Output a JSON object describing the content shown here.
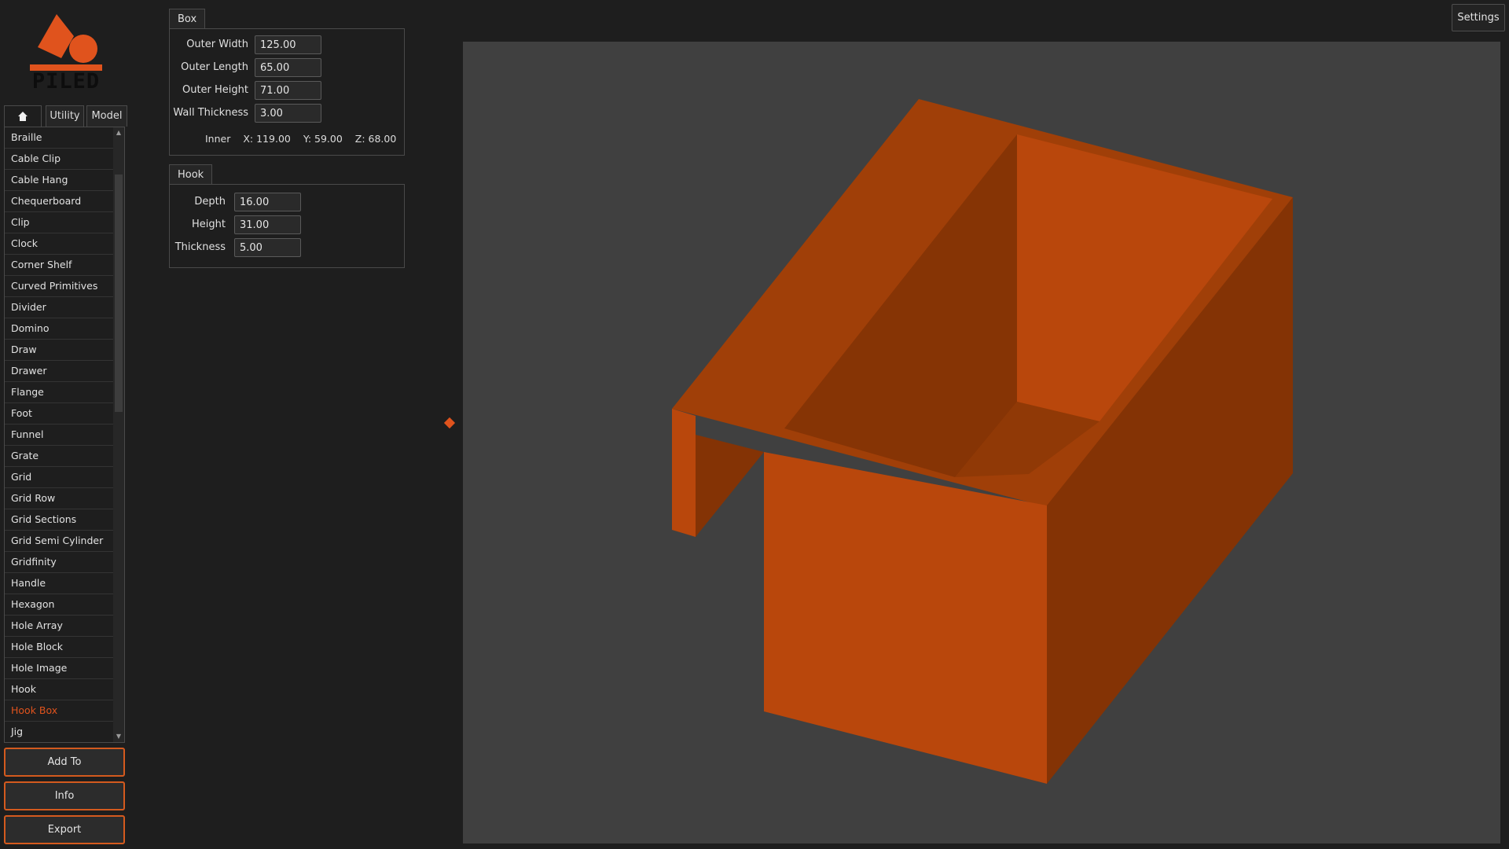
{
  "logo": {
    "text": "PILED"
  },
  "tabs": {
    "home_icon": "home-icon",
    "utility": "Utility",
    "model": "Model"
  },
  "model_list": {
    "items": [
      "Braille",
      "Cable Clip",
      "Cable Hang",
      "Chequerboard",
      "Clip",
      "Clock",
      "Corner Shelf",
      "Curved Primitives",
      "Divider",
      "Domino",
      "Draw",
      "Drawer",
      "Flange",
      "Foot",
      "Funnel",
      "Grate",
      "Grid",
      "Grid Row",
      "Grid Sections",
      "Grid Semi Cylinder",
      "Gridfinity",
      "Handle",
      "Hexagon",
      "Hole Array",
      "Hole Block",
      "Hole Image",
      "Hook",
      "Hook Box",
      "Jig"
    ],
    "selected": "Hook Box"
  },
  "buttons": {
    "add_to": "Add To",
    "info": "Info",
    "export": "Export",
    "settings": "Settings"
  },
  "box_group": {
    "title": "Box",
    "outer_width_label": "Outer Width",
    "outer_width": "125.00",
    "outer_length_label": "Outer Length",
    "outer_length": "65.00",
    "outer_height_label": "Outer Height",
    "outer_height": "71.00",
    "wall_thickness_label": "Wall Thickness",
    "wall_thickness": "3.00",
    "inner_label": "Inner",
    "inner_x": "X: 119.00",
    "inner_y": "Y: 59.00",
    "inner_z": "Z: 68.00"
  },
  "hook_group": {
    "title": "Hook",
    "depth_label": "Depth",
    "depth": "16.00",
    "height_label": "Height",
    "height": "31.00",
    "thickness_label": "Thickness",
    "thickness": "5.00"
  },
  "colors": {
    "accent": "#e0531d",
    "model_front": "#b9470c",
    "model_top": "#9f3e08",
    "model_side": "#843305",
    "viewport_bg": "#404040",
    "app_bg": "#1e1e1e"
  }
}
